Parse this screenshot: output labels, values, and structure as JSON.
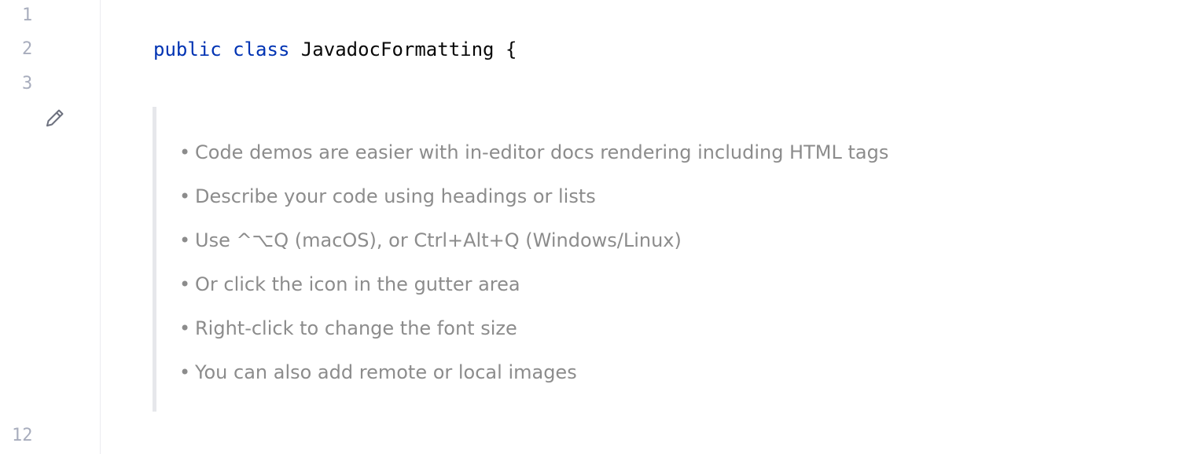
{
  "gutter": {
    "line_numbers": [
      "1",
      "2",
      "3",
      "12"
    ]
  },
  "code": {
    "kw_public": "public",
    "kw_class": "class",
    "class_name": "JavadocFormatting",
    "open_brace": "{"
  },
  "doc": {
    "bullet": "•",
    "items": [
      "Code demos are easier with in-editor docs rendering including HTML tags",
      "Describe your code using headings or lists",
      "Use ^⌥Q (macOS), or Ctrl+Alt+Q (Windows/Linux)",
      "Or click the icon in the gutter area",
      "Right-click to change the font size",
      "You can also add remote or local images"
    ]
  },
  "icons": {
    "edit": "pencil-icon"
  },
  "colors": {
    "keyword": "#0033b3",
    "text": "#080808",
    "doc_text": "#8c8c8c",
    "line_number": "#a8adbd"
  }
}
